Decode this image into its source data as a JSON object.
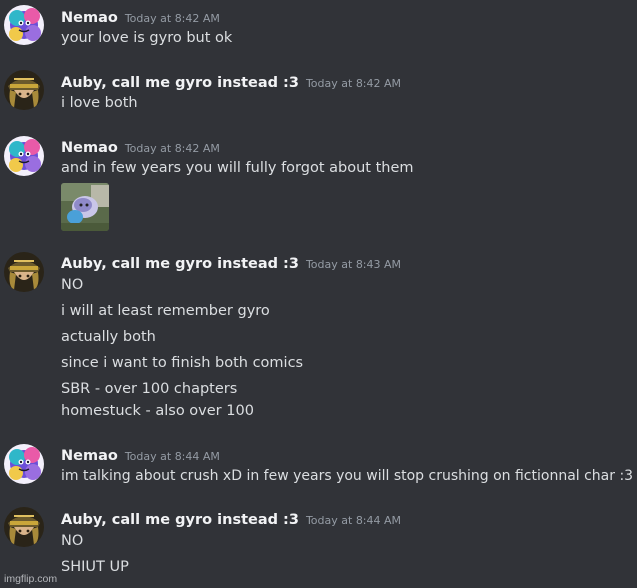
{
  "messages": [
    {
      "author": "Nemao",
      "time": "Today at 8:42 AM",
      "avatar": "nemao-avatar-icon",
      "lines": [
        "your love is gyro but ok"
      ]
    },
    {
      "author": "Auby, call me gyro instead :3",
      "time": "Today at 8:42 AM",
      "avatar": "auby-avatar-icon",
      "lines": [
        "i love both"
      ]
    },
    {
      "author": "Nemao",
      "time": "Today at 8:42 AM",
      "avatar": "nemao-avatar-icon",
      "lines": [
        "and in few years you will fully forgot about them"
      ],
      "attachment": "image-thumbnail"
    },
    {
      "author": "Auby, call me gyro instead :3",
      "time": "Today at 8:43 AM",
      "avatar": "auby-avatar-icon",
      "lines": [
        "NO",
        "i will at least remember gyro",
        "actually both",
        "since i want to finish both comics",
        "SBR - over 100 chapters",
        "homestuck - also over 100"
      ]
    },
    {
      "author": "Nemao",
      "time": "Today at 8:44 AM",
      "avatar": "nemao-avatar-icon",
      "lines": [
        "im talking about crush xD in few years you will stop crushing on fictionnal char :3"
      ]
    },
    {
      "author": "Auby, call me gyro instead :3",
      "time": "Today at 8:44 AM",
      "avatar": "auby-avatar-icon",
      "lines": [
        "NO",
        "SHIUT UP"
      ]
    }
  ],
  "watermark": "imgflip.com",
  "colors": {
    "background": "#313338",
    "username": "#f2f3f5",
    "text": "#dbdee1",
    "timestamp": "#949ba4"
  }
}
